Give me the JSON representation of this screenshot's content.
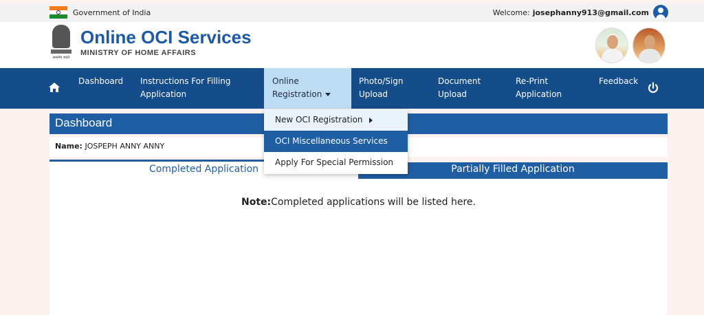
{
  "topbar": {
    "gov_label": "Government of India",
    "welcome_label": "Welcome:",
    "user_email": "josephanny913@gmail.com"
  },
  "header": {
    "title": "Online OCI Services",
    "subtitle": "MINISTRY OF HOME AFFAIRS",
    "emblem_motto": "सत्यमेव जयते"
  },
  "nav": {
    "items": [
      {
        "line1": "Dashboard",
        "line2": ""
      },
      {
        "line1": "Instructions For Filling",
        "line2": "Application"
      },
      {
        "line1": "Online",
        "line2": "Registration"
      },
      {
        "line1": "Photo/Sign",
        "line2": "Upload"
      },
      {
        "line1": "Document",
        "line2": "Upload"
      },
      {
        "line1": "Re-Print",
        "line2": "Application"
      },
      {
        "line1": "Feedback",
        "line2": ""
      }
    ]
  },
  "dropdown": {
    "items": [
      {
        "label": "New OCI Registration"
      },
      {
        "label": "OCI Miscellaneous Services"
      },
      {
        "label": "Apply For Special Permission"
      }
    ]
  },
  "dashboard": {
    "title": "Dashboard",
    "name_label": "Name:",
    "name_value": "JOSPEPH ANNY ANNY",
    "tabs": [
      {
        "label": "Completed Application"
      },
      {
        "label": "Partially Filled Application"
      }
    ],
    "note_label": "Note:",
    "note_text": "Completed applications will be listed here."
  },
  "colors": {
    "nav_bg": "#154c8a",
    "primary_blue": "#1f5ea3",
    "active_nav_bg": "#bfdcf5",
    "page_bg": "#fdf2ef"
  },
  "icons": {
    "home": "home-icon",
    "power": "power-icon",
    "user": "user-icon"
  }
}
